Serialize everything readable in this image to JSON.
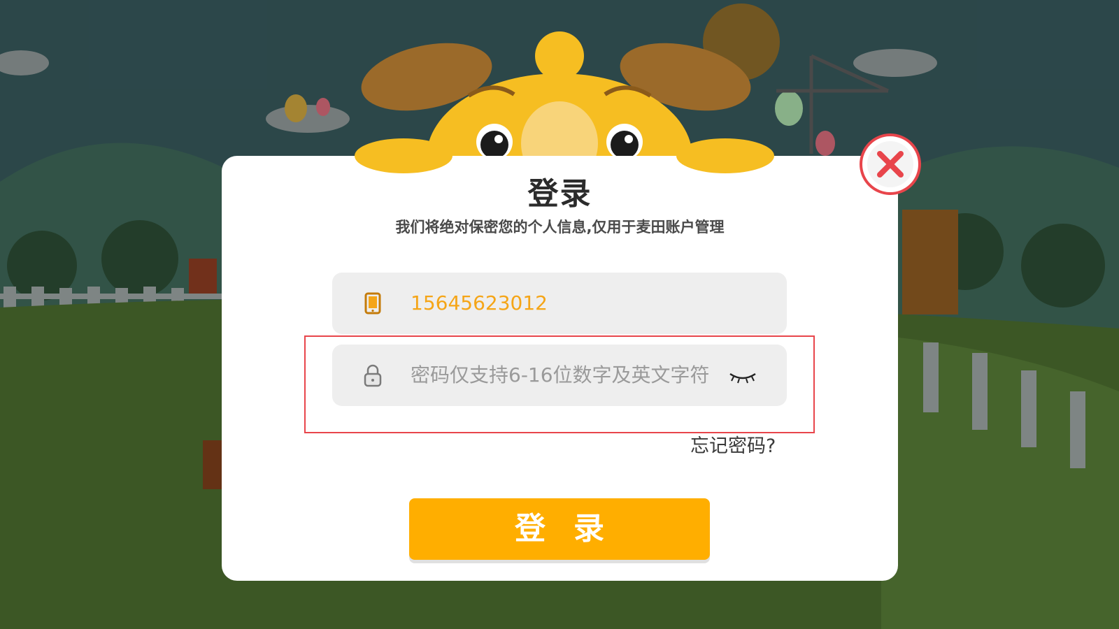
{
  "dialog": {
    "title": "登录",
    "subtitle": "我们将绝对保密您的个人信息,仅用于麦田账户管理"
  },
  "phone_field": {
    "value": "15645623012",
    "icon": "phone-icon"
  },
  "password_field": {
    "placeholder": "密码仅支持6-16位数字及英文字符",
    "icon": "lock-icon",
    "toggle_icon": "eye-closed-icon"
  },
  "forgot_link": "忘记密码?",
  "login_button": "登录",
  "close_icon": "close-icon",
  "colors": {
    "accent": "#ffae00",
    "value_text": "#f5a517",
    "close_red": "#e8454b",
    "highlight": "#e8454b"
  }
}
